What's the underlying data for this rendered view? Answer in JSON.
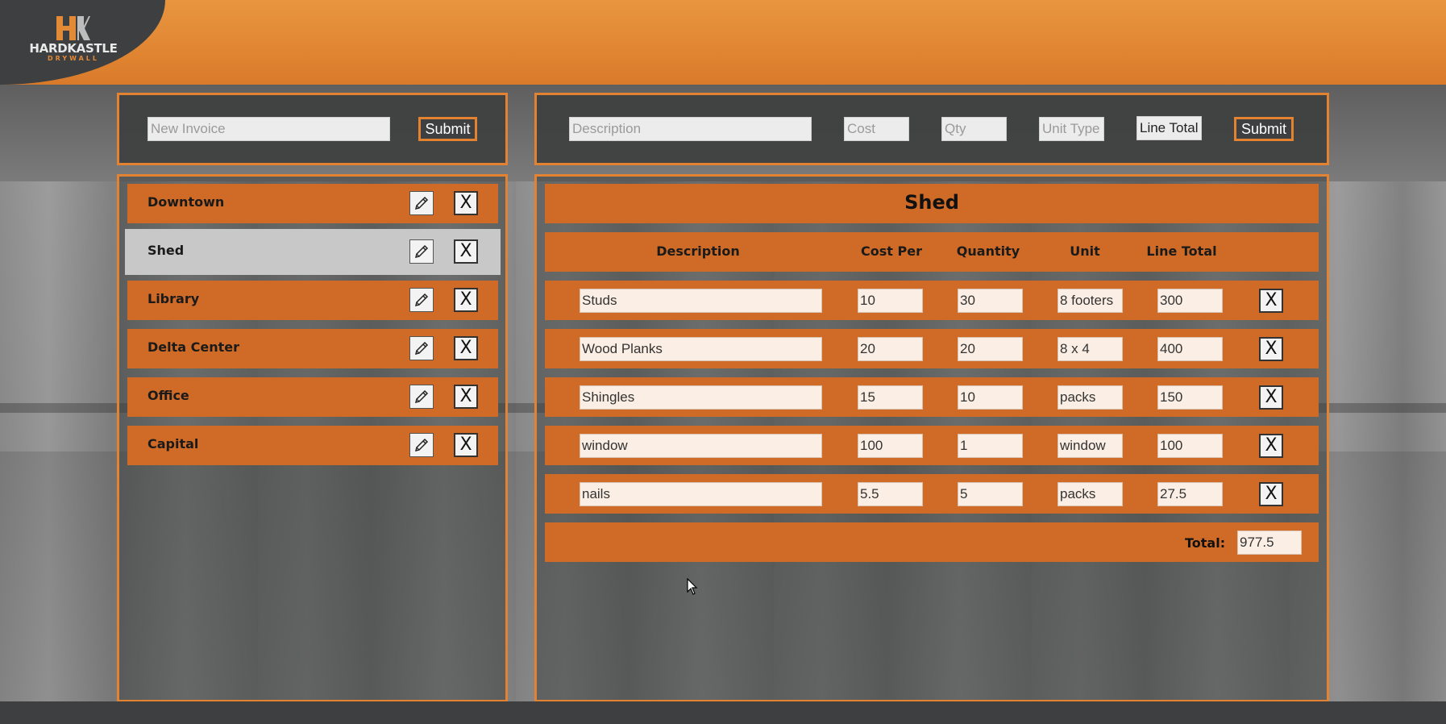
{
  "brand": {
    "logo_letters": "HK",
    "name": "HARDKASTLE",
    "sub": "DRYWALL",
    "accent": "#e38331",
    "dark": "#3d3f40"
  },
  "invoice_form": {
    "placeholder": "New Invoice",
    "submit_label": "Submit"
  },
  "item_form": {
    "description_placeholder": "Description",
    "cost_placeholder": "Cost",
    "qty_placeholder": "Qty",
    "unit_placeholder": "Unit Type",
    "line_total_label": "Line Total",
    "submit_label": "Submit"
  },
  "invoices": [
    {
      "name": "Downtown",
      "selected": false
    },
    {
      "name": "Shed",
      "selected": true
    },
    {
      "name": "Library",
      "selected": false
    },
    {
      "name": "Delta Center",
      "selected": false
    },
    {
      "name": "Office",
      "selected": false
    },
    {
      "name": "Capital",
      "selected": false
    }
  ],
  "detail": {
    "title": "Shed",
    "columns": {
      "description": "Description",
      "cost_per": "Cost Per",
      "quantity": "Quantity",
      "unit": "Unit",
      "line_total": "Line Total"
    },
    "rows": [
      {
        "description": "Studs",
        "cost": "10",
        "qty": "30",
        "unit": "8 footers",
        "total": "300"
      },
      {
        "description": "Wood Planks",
        "cost": "20",
        "qty": "20",
        "unit": "8 x 4",
        "total": "400"
      },
      {
        "description": "Shingles",
        "cost": "15",
        "qty": "10",
        "unit": "packs",
        "total": "150"
      },
      {
        "description": "window",
        "cost": "100",
        "qty": "1",
        "unit": "window",
        "total": "100"
      },
      {
        "description": "nails",
        "cost": "5.5",
        "qty": "5",
        "unit": "packs",
        "total": "27.5"
      }
    ],
    "total_label": "Total:",
    "total_value": "977.5"
  },
  "icons": {
    "edit": "pencil-icon",
    "delete": "close-icon"
  }
}
